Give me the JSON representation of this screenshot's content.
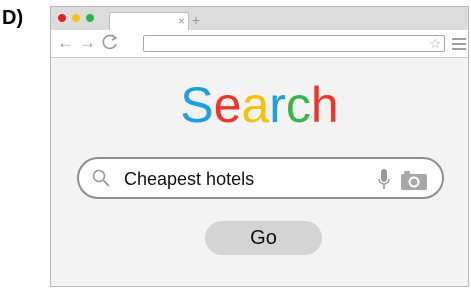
{
  "panel_label": "D)",
  "browser": {
    "tab": {
      "title": "",
      "close_glyph": "×"
    },
    "new_tab_glyph": "+",
    "nav": {
      "back_glyph": "←",
      "forward_glyph": "→",
      "reload_glyph": "C"
    },
    "url": {
      "value": ""
    },
    "bookmark_glyph": "☆",
    "window_buttons": [
      "close",
      "minimize",
      "maximize"
    ]
  },
  "logo": {
    "letters": [
      {
        "char": "S",
        "color": "#1aa1e0"
      },
      {
        "char": "e",
        "color": "#ee3524"
      },
      {
        "char": "a",
        "color": "#f4c20d"
      },
      {
        "char": "r",
        "color": "#1aa1e0"
      },
      {
        "char": "c",
        "color": "#3ab54a"
      },
      {
        "char": "h",
        "color": "#ee3524"
      }
    ]
  },
  "search": {
    "value": "Cheapest hotels"
  },
  "go_button": {
    "label": "Go"
  },
  "icons": {
    "search": "search-icon",
    "mic": "microphone-icon",
    "camera": "camera-icon",
    "menu": "hamburger-menu-icon",
    "star": "star-icon"
  }
}
